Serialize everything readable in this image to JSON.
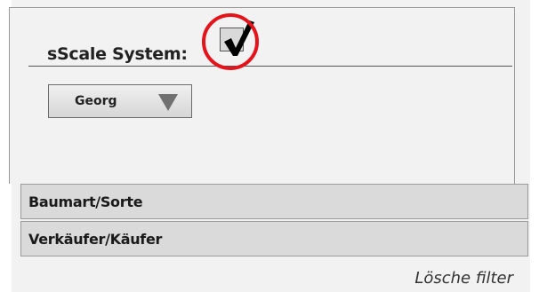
{
  "filter_panel": {
    "scale_system": {
      "label": "sScale System:",
      "checked": true
    },
    "dropdown": {
      "selected_value": "Georg"
    },
    "accordion": [
      {
        "label": "Baumart/Sorte"
      },
      {
        "label": "Verkäufer/Käufer"
      }
    ],
    "clear_filter_label": "Lösche filter"
  },
  "colors": {
    "panel_background": "#f2f2f2",
    "accordion_background": "#dadada",
    "highlight_ring": "#e3141b",
    "border": "#9a9a9a"
  },
  "icons": {
    "checkbox_mark": "checkmark-icon",
    "dropdown_arrow": "chevron-down-icon",
    "highlight": "highlight-circle"
  }
}
